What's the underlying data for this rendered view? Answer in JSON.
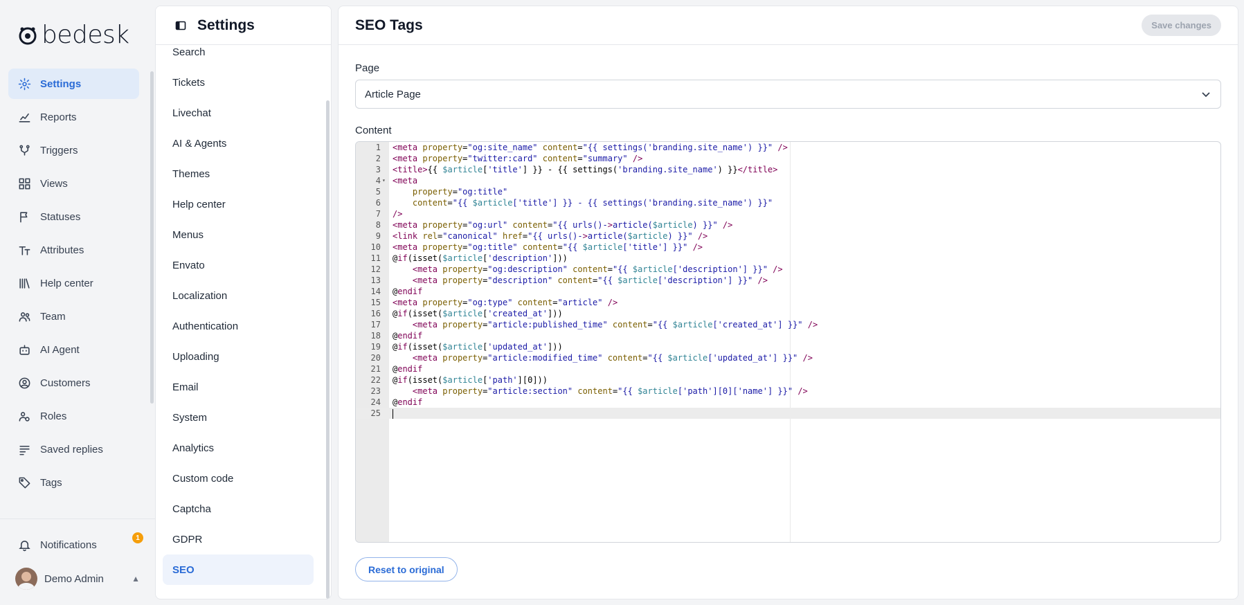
{
  "app": {
    "logo_text": "bedesk"
  },
  "leftnav": {
    "items": [
      {
        "label": "Settings",
        "icon": "gear-icon",
        "active": true
      },
      {
        "label": "Reports",
        "icon": "chart-icon"
      },
      {
        "label": "Triggers",
        "icon": "branch-icon"
      },
      {
        "label": "Views",
        "icon": "grid-icon"
      },
      {
        "label": "Statuses",
        "icon": "flag-icon"
      },
      {
        "label": "Attributes",
        "icon": "text-size-icon"
      },
      {
        "label": "Help center",
        "icon": "library-icon"
      },
      {
        "label": "Team",
        "icon": "people-icon"
      },
      {
        "label": "AI Agent",
        "icon": "robot-icon"
      },
      {
        "label": "Customers",
        "icon": "user-circle-icon"
      },
      {
        "label": "Roles",
        "icon": "user-gear-icon"
      },
      {
        "label": "Saved replies",
        "icon": "reply-list-icon"
      },
      {
        "label": "Tags",
        "icon": "tag-icon"
      }
    ],
    "notifications_label": "Notifications",
    "notifications_count": "1",
    "user_name": "Demo Admin"
  },
  "settings": {
    "title": "Settings",
    "items": [
      "Search",
      "Tickets",
      "Livechat",
      "AI & Agents",
      "Themes",
      "Help center",
      "Menus",
      "Envato",
      "Localization",
      "Authentication",
      "Uploading",
      "Email",
      "System",
      "Analytics",
      "Custom code",
      "Captcha",
      "GDPR",
      "SEO"
    ],
    "active": "SEO"
  },
  "main": {
    "title": "SEO Tags",
    "save_label": "Save changes",
    "page_label": "Page",
    "page_value": "Article Page",
    "content_label": "Content",
    "reset_label": "Reset to original",
    "current_line": 25,
    "code_lines": [
      "<meta property=\"og:site_name\" content=\"{{ settings('branding.site_name') }}\" />",
      "<meta property=\"twitter:card\" content=\"summary\" />",
      "<title>{{ $article['title'] }} - {{ settings('branding.site_name') }}</title>",
      "<meta",
      "    property=\"og:title\"",
      "    content=\"{{ $article['title'] }} - {{ settings('branding.site_name') }}\"",
      "/>",
      "<meta property=\"og:url\" content=\"{{ urls()->article($article) }}\" />",
      "<link rel=\"canonical\" href=\"{{ urls()->article($article) }}\" />",
      "<meta property=\"og:title\" content=\"{{ $article['title'] }}\" />",
      "@if(isset($article['description']))",
      "    <meta property=\"og:description\" content=\"{{ $article['description'] }}\" />",
      "    <meta property=\"description\" content=\"{{ $article['description'] }}\" />",
      "@endif",
      "<meta property=\"og:type\" content=\"article\" />",
      "@if(isset($article['created_at']))",
      "    <meta property=\"article:published_time\" content=\"{{ $article['created_at'] }}\" />",
      "@endif",
      "@if(isset($article['updated_at']))",
      "    <meta property=\"article:modified_time\" content=\"{{ $article['updated_at'] }}\" />",
      "@endif",
      "@if(isset($article['path'][0]))",
      "    <meta property=\"article:section\" content=\"{{ $article['path'][0]['name'] }}\" />",
      "@endif",
      ""
    ]
  }
}
